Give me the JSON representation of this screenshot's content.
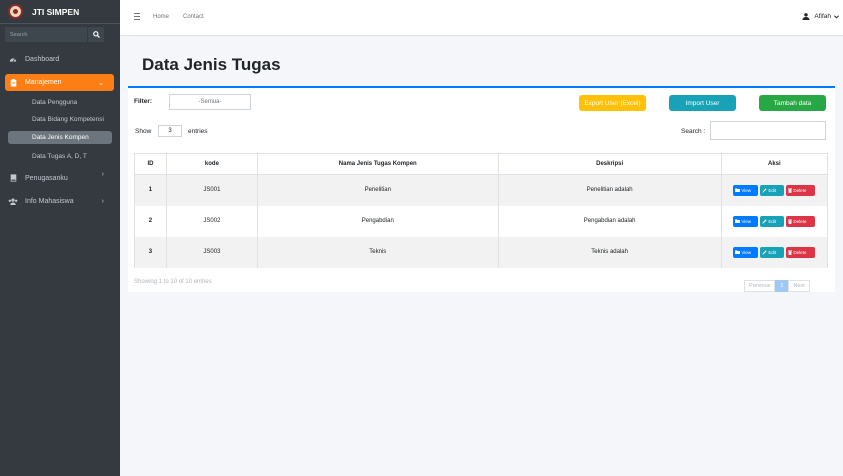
{
  "brand": {
    "title": "JTI SIMPEN"
  },
  "sidebar": {
    "search_placeholder": "Search",
    "items": [
      {
        "label": "Dashboard",
        "icon": "dashboard-icon"
      },
      {
        "label": "Manajemen",
        "icon": "clipboard-icon",
        "chevron": "⌄"
      },
      {
        "label": "Penugasanku",
        "icon": "book-icon",
        "chevron": "›"
      },
      {
        "label": "Info Mahasiswa",
        "icon": "users-icon",
        "chevron": "›"
      }
    ],
    "submenu": [
      {
        "label": "Data Pengguna"
      },
      {
        "label": "Data Bidang Kompetensi"
      },
      {
        "label": "Data Jenis Kompen"
      },
      {
        "label": "Data Tugas A, D, T"
      }
    ]
  },
  "topbar": {
    "links": [
      "Home",
      "Contact"
    ],
    "user_name": "Afifah"
  },
  "page": {
    "title": "Data  Jenis Tugas"
  },
  "toolbar": {
    "filter_label": "Filter:",
    "filter_value": "-Semua-",
    "export_label": "Export User (Excel)",
    "import_label": "Import User",
    "add_label": "Tambah data",
    "colors": {
      "export": "#ffc107",
      "import": "#17a2b8",
      "add": "#28a745"
    }
  },
  "table_controls": {
    "show_label": "Show",
    "show_value": "3",
    "entries_label": "entries",
    "search_label": "Search :"
  },
  "table": {
    "headers": [
      "ID",
      "kode",
      "Nama Jenis Tugas Kompen",
      "Deskripsi",
      "Aksi"
    ],
    "rows": [
      {
        "id": "1",
        "kode": "JS001",
        "nama": "Penelitian",
        "deskripsi": "Penelitian adalah"
      },
      {
        "id": "2",
        "kode": "JS002",
        "nama": "Pengabdian",
        "deskripsi": "Pengabdian adalah"
      },
      {
        "id": "3",
        "kode": "JS003",
        "nama": "Teknis",
        "deskripsi": "Teknis adalah"
      }
    ],
    "action_labels": {
      "view": "View",
      "edit": "Edit",
      "delete": "Delete"
    }
  },
  "footer": {
    "showing_text": "Showing 1 to 10 of 10 entries",
    "pagination": {
      "previous": "Previous",
      "current": "1",
      "next": "Next"
    }
  }
}
